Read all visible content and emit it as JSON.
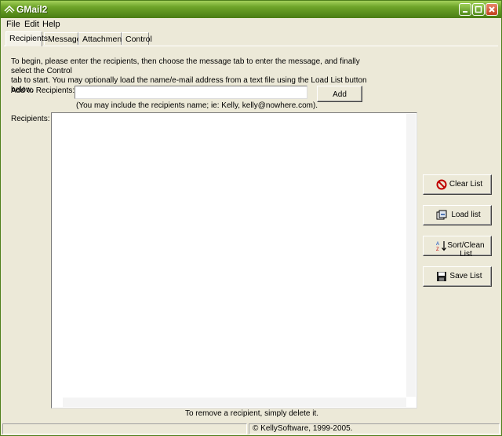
{
  "window": {
    "title": "GMail2"
  },
  "menu": {
    "file": "File",
    "edit": "Edit",
    "help": "Help"
  },
  "tabs": [
    {
      "label": "Recipients",
      "active": true
    },
    {
      "label": "Message",
      "active": false
    },
    {
      "label": "Attachments",
      "active": false
    },
    {
      "label": "Control",
      "active": false
    }
  ],
  "recipients": {
    "intro_line1": "To begin, please enter the recipients, then choose the message tab to enter the message, and finally select the Control",
    "intro_line2": "tab to start.  You may optionally load the name/e-mail address from a text file using the Load List button below.",
    "add_label": "Add to Recipients:",
    "add_value": "",
    "add_button": "Add",
    "hint": "(You may include the recipients name; ie: Kelly, kelly@nowhere.com).",
    "list_label": "Recipients:",
    "items": [],
    "clear_button": "Clear List",
    "load_button": "Load list",
    "sort_button": "Sort/Clean List",
    "save_button": "Save List",
    "remove_note": "To remove a recipient, simply delete it."
  },
  "status": {
    "left": "",
    "right": "© KellySoftware, 1999-2005."
  },
  "colors": {
    "titlebar": "#5a8f1d",
    "face": "#ece9d8"
  }
}
